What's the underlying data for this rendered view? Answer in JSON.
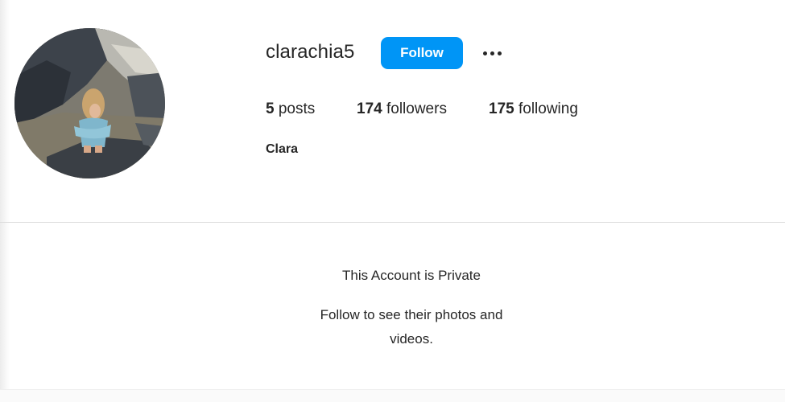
{
  "profile": {
    "username": "clarachia5",
    "display_name": "Clara",
    "follow_label": "Follow",
    "more_icon": "more-options-icon",
    "avatar_icon": "profile-photo",
    "stats": {
      "posts_count": "5",
      "posts_label": "posts",
      "followers_count": "174",
      "followers_label": "followers",
      "following_count": "175",
      "following_label": "following"
    }
  },
  "private_notice": {
    "title": "This Account is Private",
    "subtitle": "Follow to see their photos and videos."
  },
  "colors": {
    "follow_button": "#0095f6",
    "text": "#262626",
    "divider": "#dbdbdb"
  }
}
